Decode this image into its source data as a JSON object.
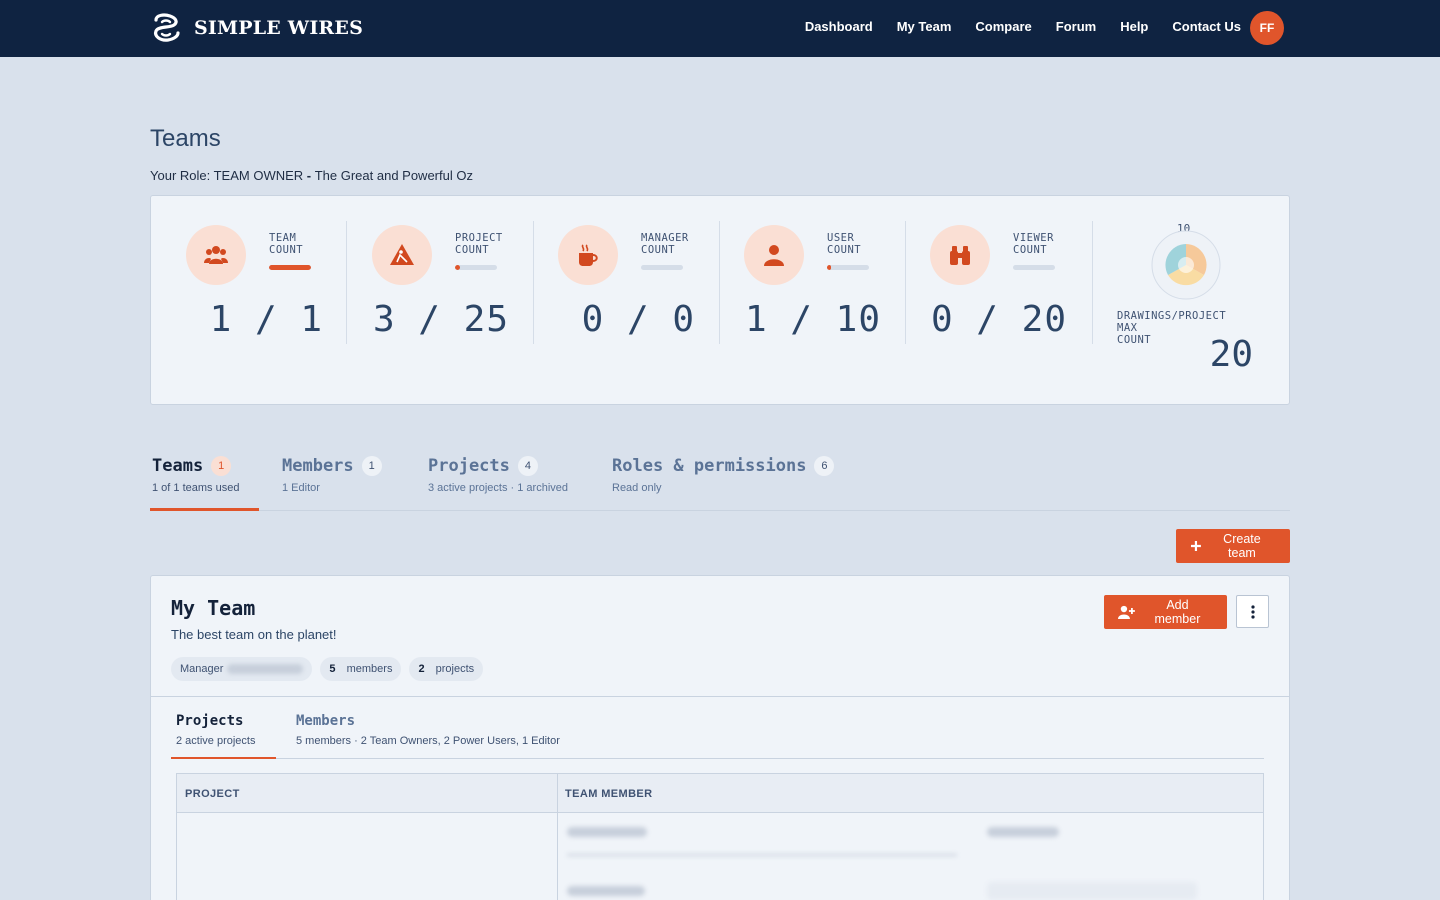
{
  "navbar": {
    "brand": "SIMPLE WIRES",
    "links": [
      "Dashboard",
      "My Team",
      "Compare",
      "Forum",
      "Help",
      "Contact Us"
    ],
    "avatar_initials": "FF"
  },
  "header": {
    "title": "Teams",
    "role_prefix": "Your Role: TEAM OWNER",
    "role_separator": " - ",
    "role_name": "The Great and Powerful Oz"
  },
  "stats": [
    {
      "label_line1": "TEAM",
      "label_line2": "COUNT",
      "value": "1 / 1",
      "used": 1,
      "total": 1,
      "icon": "users-icon"
    },
    {
      "label_line1": "PROJECT",
      "label_line2": "COUNT",
      "value": "3 / 25",
      "used": 3,
      "total": 25,
      "icon": "construction-icon"
    },
    {
      "label_line1": "MANAGER",
      "label_line2": "COUNT",
      "value": "0 / 0",
      "used": 0,
      "total": 0,
      "icon": "coffee-icon"
    },
    {
      "label_line1": "USER",
      "label_line2": "COUNT",
      "value": "1 / 10",
      "used": 1,
      "total": 10,
      "icon": "user-icon"
    },
    {
      "label_line1": "VIEWER",
      "label_line2": "COUNT",
      "value": "0 / 20",
      "used": 0,
      "total": 20,
      "icon": "binoculars-icon"
    }
  ],
  "drawings": {
    "donut_top_label": "10",
    "label_line1": "DRAWINGS/PROJECT",
    "label_line2": "MAX",
    "label_line3": "COUNT",
    "value": "20"
  },
  "tabs": [
    {
      "title": "Teams",
      "badge": "1",
      "sub": "1 of 1 teams used"
    },
    {
      "title": "Members",
      "badge": "1",
      "sub": "1 Editor"
    },
    {
      "title": "Projects",
      "badge": "4",
      "sub": "3 active projects · 1 archived"
    },
    {
      "title": "Roles & permissions",
      "badge": "6",
      "sub": "Read only"
    }
  ],
  "create_team_label": "Create team",
  "team": {
    "name": "My Team",
    "description": "The best team on the planet!",
    "chip_manager": "Manager",
    "chip_members_count": "5",
    "chip_members_label": "members",
    "chip_projects_count": "2",
    "chip_projects_label": "projects",
    "add_member_label": "Add member",
    "subtabs": [
      {
        "title": "Projects",
        "sub": "2 active projects"
      },
      {
        "title": "Members",
        "sub": "5 members · 2 Team Owners, 2 Power Users, 1 Editor"
      }
    ],
    "table_headers": [
      "PROJECT",
      "TEAM MEMBER"
    ]
  },
  "colors": {
    "accent": "#e0552b",
    "navbar": "#0f2341",
    "background": "#d9e1ec"
  }
}
